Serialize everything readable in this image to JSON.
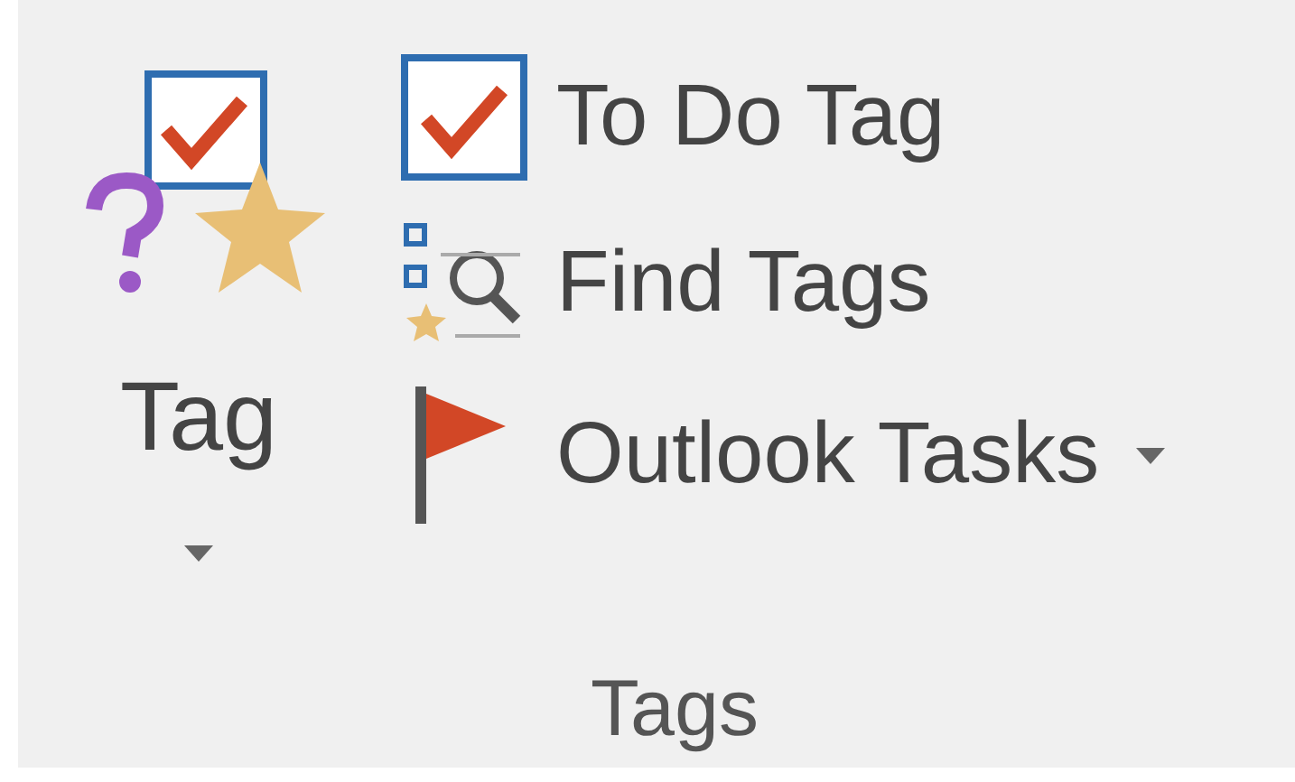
{
  "tag_button": {
    "label": "Tag"
  },
  "commands": [
    {
      "kind": "todo",
      "label": "To Do Tag",
      "dropdown": false
    },
    {
      "kind": "find",
      "label": "Find Tags",
      "dropdown": false
    },
    {
      "kind": "flag",
      "label": "Outlook Tasks",
      "dropdown": true
    }
  ],
  "group_label": "Tags"
}
